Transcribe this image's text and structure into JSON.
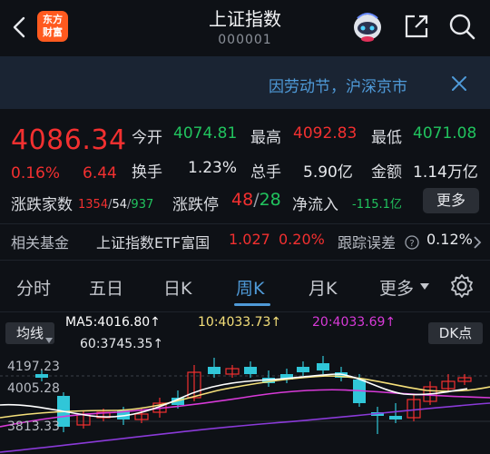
{
  "header": {
    "logo_line1": "东方",
    "logo_line2": "财富",
    "title": "上证指数",
    "code": "000001"
  },
  "banner": {
    "text": "因劳动节，沪深京市"
  },
  "quote": {
    "price": "4086.34",
    "change_pct": "0.16%",
    "change": "6.44",
    "open_label": "今开",
    "open": "4074.81",
    "high_label": "最高",
    "high": "4092.83",
    "low_label": "最低",
    "low": "4071.08",
    "turnover_label": "换手",
    "turnover": "1.23%",
    "volume_label": "总手",
    "volume": "5.90亿",
    "amount_label": "金额",
    "amount": "1.14万亿",
    "breadth_label": "涨跌家数",
    "up_count": "1354",
    "flat_count": "54",
    "down_count": "937",
    "limit_label": "涨跌停",
    "limit_up": "48",
    "limit_down": "28",
    "netflow_label": "净流入",
    "netflow": "-115.1亿",
    "more_label": "更多"
  },
  "fund": {
    "label": "相关基金",
    "name": "上证指数ETF富国",
    "price": "1.027",
    "pct": "0.20%",
    "tracking_label": "跟踪误差",
    "tracking": "0.12%"
  },
  "tabs": [
    {
      "label": "分时"
    },
    {
      "label": "五日"
    },
    {
      "label": "日K"
    },
    {
      "label": "周K"
    },
    {
      "label": "月K"
    },
    {
      "label": "更多"
    }
  ],
  "active_tab": "周K",
  "ma": {
    "selector": "均线",
    "ma5": "MA5:4016.80↑",
    "ma10": "10:4033.73↑",
    "ma20": "20:4033.69↑",
    "ma60": "60:3745.35↑",
    "dk": "DK点"
  },
  "axis": {
    "top": "4197.23",
    "mid": "4005.28",
    "bottom": "3813.33"
  },
  "colors": {
    "up": "#f23030",
    "down": "#21c35e",
    "accent": "#4f9ad8",
    "candle_down": "#30c6d8",
    "ma5": "#ffffff",
    "ma10": "#f5e07a",
    "ma20": "#d83ad8",
    "ma60": "#8a3ad8"
  }
}
